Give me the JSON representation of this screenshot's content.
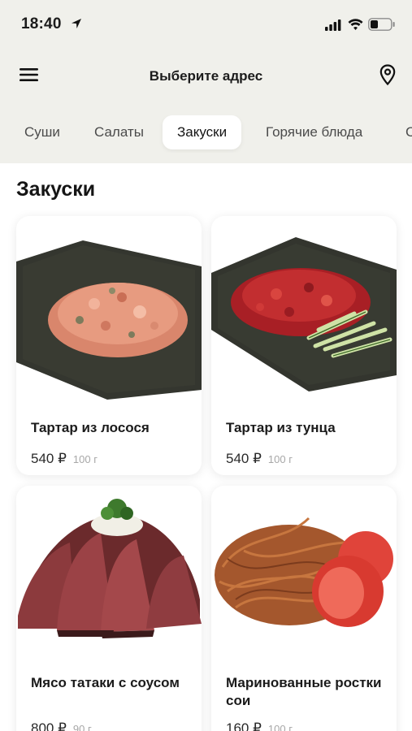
{
  "status_bar": {
    "time": "18:40",
    "icons": [
      "location-arrow-icon",
      "cellular-signal-icon",
      "wifi-icon",
      "battery-icon"
    ]
  },
  "header": {
    "title": "Выберите адрес",
    "menu_icon": "hamburger-menu-icon",
    "location_icon": "map-pin-icon"
  },
  "tabs": [
    {
      "label": "Суши",
      "active": false
    },
    {
      "label": "Салаты",
      "active": false
    },
    {
      "label": "Закуски",
      "active": true
    },
    {
      "label": "Горячие блюда",
      "active": false
    },
    {
      "label": "С",
      "active": false
    }
  ],
  "section": {
    "title": "Закуски"
  },
  "products": [
    {
      "name": "Тартар из лосося",
      "price": "540 ₽",
      "weight": "100 г",
      "image": "salmon-tartare-on-nori"
    },
    {
      "name": "Тартар из тунца",
      "price": "540 ₽",
      "weight": "100 г",
      "image": "tuna-tartare-on-nori"
    },
    {
      "name": "Мясо татаки с соусом",
      "price": "800 ₽",
      "weight": "90 г",
      "image": "beef-tataki"
    },
    {
      "name": "Маринованные ростки сои",
      "price": "160 ₽",
      "weight": "100 г",
      "image": "marinated-soy-sprouts"
    }
  ],
  "colors": {
    "header_bg": "#f0f0eb",
    "page_bg": "#ffffff",
    "text": "#1c1c1c",
    "muted": "#a7a7a7"
  }
}
